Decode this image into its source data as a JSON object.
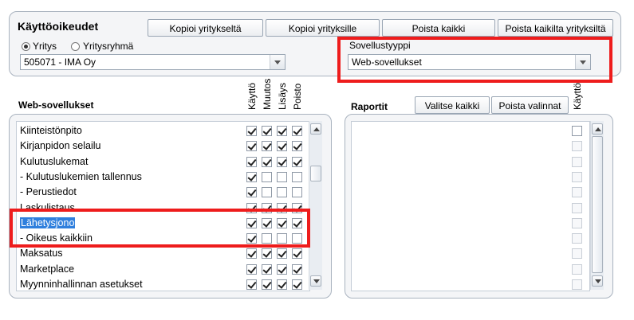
{
  "header": {
    "title": "Käyttöoikeudet",
    "buttons": [
      "Kopioi yritykseltä",
      "Kopioi yrityksille",
      "Poista kaikki",
      "Poista kaikilta yrityksiltä"
    ]
  },
  "scope": {
    "radio_company": "Yritys",
    "radio_group": "Yritysryhmä",
    "selected": "Yritys",
    "company_value": "505071 - IMA Oy"
  },
  "app_type": {
    "label": "Sovellustyyppi",
    "value": "Web-sovellukset"
  },
  "web_apps": {
    "title": "Web-sovellukset",
    "columns": [
      "Käyttö",
      "Muutos",
      "Lisäys",
      "Poisto"
    ],
    "rows": [
      {
        "label": "Kiinteistönpito",
        "checks": [
          true,
          true,
          true,
          true
        ]
      },
      {
        "label": "Kirjanpidon selailu",
        "checks": [
          true,
          true,
          true,
          true
        ]
      },
      {
        "label": "Kulutuslukemat",
        "checks": [
          true,
          true,
          true,
          true
        ]
      },
      {
        "label": "- Kulutuslukemien tallennus",
        "checks": [
          true,
          false,
          false,
          false
        ]
      },
      {
        "label": "- Perustiedot",
        "checks": [
          true,
          false,
          false,
          false
        ]
      },
      {
        "label": "Laskulistaus",
        "checks": [
          true,
          true,
          true,
          true
        ]
      },
      {
        "label": "Lähetysjono",
        "checks": [
          true,
          true,
          true,
          true
        ],
        "selected": true
      },
      {
        "label": "- Oikeus kaikkiin",
        "checks": [
          true,
          false,
          false,
          false
        ]
      },
      {
        "label": "Maksatus",
        "checks": [
          true,
          true,
          true,
          true
        ]
      },
      {
        "label": "Marketplace",
        "checks": [
          true,
          true,
          true,
          true
        ]
      },
      {
        "label": "Myynninhallinnan asetukset",
        "checks": [
          true,
          true,
          true,
          true
        ]
      }
    ]
  },
  "reports": {
    "title": "Raportit",
    "select_all": "Valitse kaikki",
    "clear_all": "Poista valinnat",
    "column": "Käyttö",
    "row_count": 11
  },
  "colors": {
    "highlight": "#ee1c1c",
    "selection": "#2f7fdd"
  }
}
